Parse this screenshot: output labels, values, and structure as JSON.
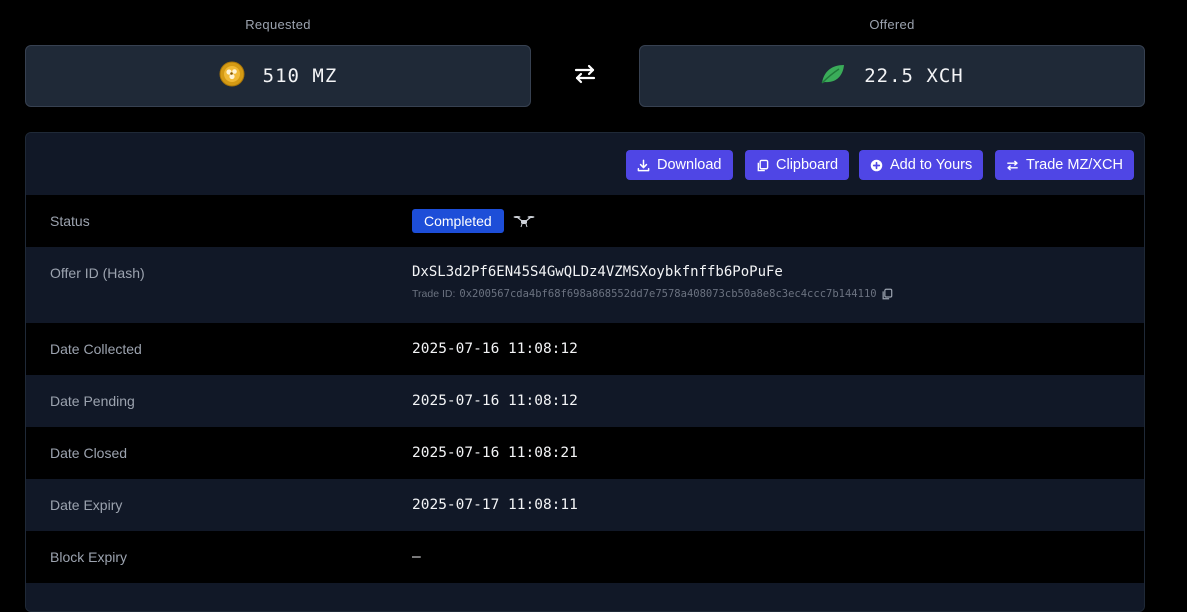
{
  "summary": {
    "requested": {
      "caption": "Requested",
      "amount": "510 MZ",
      "icon": "mz-token-icon"
    },
    "offered": {
      "caption": "Offered",
      "amount": "22.5 XCH",
      "icon": "chia-leaf-icon"
    },
    "swap_icon": "swap-arrows-icon"
  },
  "toolbar": {
    "download_label": "Download",
    "clipboard_label": "Clipboard",
    "add_label": "Add to Yours",
    "trade_label": "Trade MZ/XCH"
  },
  "details": {
    "status": {
      "label": "Status",
      "value": "Completed"
    },
    "offer_id": {
      "label": "Offer ID (Hash)",
      "value": "DxSL3d2Pf6EN45S4GwQLDz4VZMSXoybkfnffb6PoPuFe",
      "trade_prefix": "Trade ID:",
      "trade_id": "0x200567cda4bf68f698a868552dd7e7578a408073cb50a8e8c3ec4ccc7b144110"
    },
    "date_collected": {
      "label": "Date Collected",
      "value": "2025-07-16 11:08:12"
    },
    "date_pending": {
      "label": "Date Pending",
      "value": "2025-07-16 11:08:12"
    },
    "date_closed": {
      "label": "Date Closed",
      "value": "2025-07-16 11:08:21"
    },
    "date_expiry": {
      "label": "Date Expiry",
      "value": "2025-07-17 11:08:11"
    },
    "block_expiry": {
      "label": "Block Expiry",
      "value": "—"
    }
  },
  "colors": {
    "accent_button": "#4f46e5",
    "status_badge": "#1d4ed8",
    "chia_green": "#3aac59",
    "mz_gold": "#d49a14"
  }
}
